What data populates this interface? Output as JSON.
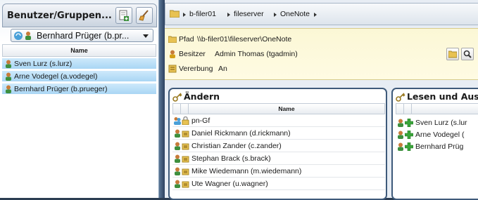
{
  "left": {
    "title": "Benutzer/Gruppen...",
    "selected_user": "Bernhard Prüger (b.pr...",
    "column_header": "Name",
    "users": [
      {
        "label": "Sven Lurz (s.lurz)"
      },
      {
        "label": "Arne Vodegel (a.vodegel)"
      },
      {
        "label": "Bernhard Prüger (b.prueger)"
      }
    ]
  },
  "breadcrumb": [
    "b-filer01",
    "fileserver",
    "OneNote"
  ],
  "properties": {
    "path_label": "Pfad",
    "path_value": "\\\\b-filer01\\fileserver\\OneNote",
    "owner_label": "Besitzer",
    "owner_value": "Admin Thomas (tgadmin)",
    "inherit_label": "Vererbung",
    "inherit_value": "An"
  },
  "groups": {
    "change": {
      "title": "Ändern",
      "column_header": "Name",
      "rows": [
        {
          "label": "pn-Gf"
        },
        {
          "label": "Daniel Rickmann (d.rickmann)"
        },
        {
          "label": "Christian Zander (c.zander)"
        },
        {
          "label": "Stephan Brack (s.brack)"
        },
        {
          "label": "Mike Wiedemann (m.wiedemann)"
        },
        {
          "label": "Ute Wagner (u.wagner)"
        }
      ]
    },
    "read_execute": {
      "title": "Lesen und Ausf",
      "rows": [
        {
          "label": "Sven Lurz (s.lur"
        },
        {
          "label": "Arne Vodegel ("
        },
        {
          "label": "Bernhard Prüg"
        }
      ]
    }
  },
  "colors": {
    "row_selected": "#a9d6f4",
    "panel_border": "#3e5a7a",
    "props_background": "#fbf7d5",
    "background": "#2b3d52"
  }
}
